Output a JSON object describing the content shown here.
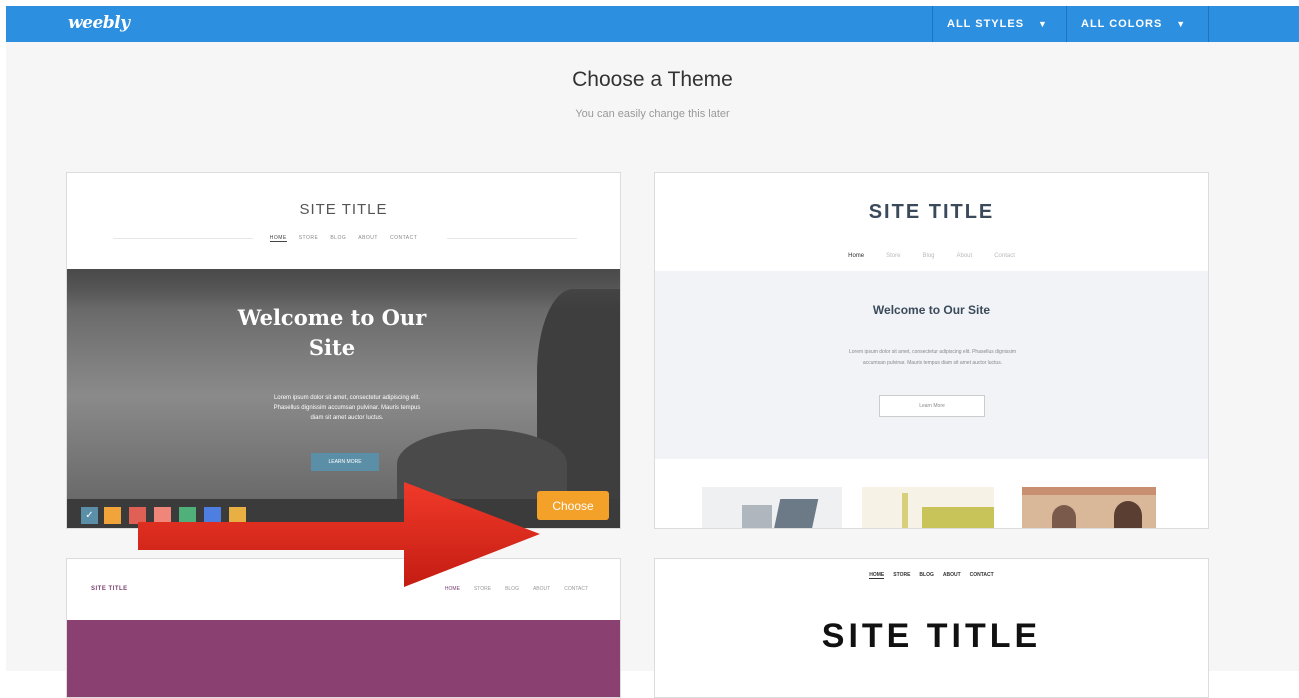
{
  "topbar": {
    "logo": "weebly",
    "all_styles": "ALL STYLES",
    "all_colors": "ALL COLORS"
  },
  "page": {
    "title": "Choose a Theme",
    "subtitle": "You can easily change this later"
  },
  "themes": [
    {
      "site_title": "SITE TITLE",
      "nav": [
        "HOME",
        "STORE",
        "BLOG",
        "ABOUT",
        "CONTACT"
      ],
      "hero_title_line1": "Welcome to Our",
      "hero_title_line2": "Site",
      "hero_body_line1": "Lorem ipsum dolor sit amet, consectetur adipiscing elit.",
      "hero_body_line2": "Phasellus dignissim accumsan pulvinar. Mauris tempus",
      "hero_body_line3": "diam sit amet auctor luctus.",
      "learn_more": "LEARN MORE",
      "choose_label": "Choose",
      "swatch_colors": [
        "#5b8fa8",
        "#f0a43a",
        "#e06055",
        "#f0867a",
        "#4fb07a",
        "#4e7fe0",
        "#e8b042"
      ]
    },
    {
      "site_title": "SITE TITLE",
      "nav": [
        "Home",
        "Store",
        "Blog",
        "About",
        "Contact"
      ],
      "hero_title": "Welcome to Our Site",
      "hero_body_line1": "Lorem ipsum dolor sit amet, consectetur adipiscing elit. Phasellus dignissim",
      "hero_body_line2": "accumsan pulvinar. Mauris tempus diam sit amet auctor luctus.",
      "learn_more": "Learn More"
    },
    {
      "site_title": "SITE TITLE",
      "nav": [
        "HOME",
        "STORE",
        "BLOG",
        "ABOUT",
        "CONTACT"
      ],
      "accent_color": "#8a4171"
    },
    {
      "site_title": "SITE TITLE",
      "nav": [
        "HOME",
        "STORE",
        "BLOG",
        "ABOUT",
        "CONTACT"
      ]
    }
  ],
  "colors": {
    "topbar": "#2d8fe0",
    "choose_button": "#f4a12a",
    "arrow": "#e02a1e"
  }
}
